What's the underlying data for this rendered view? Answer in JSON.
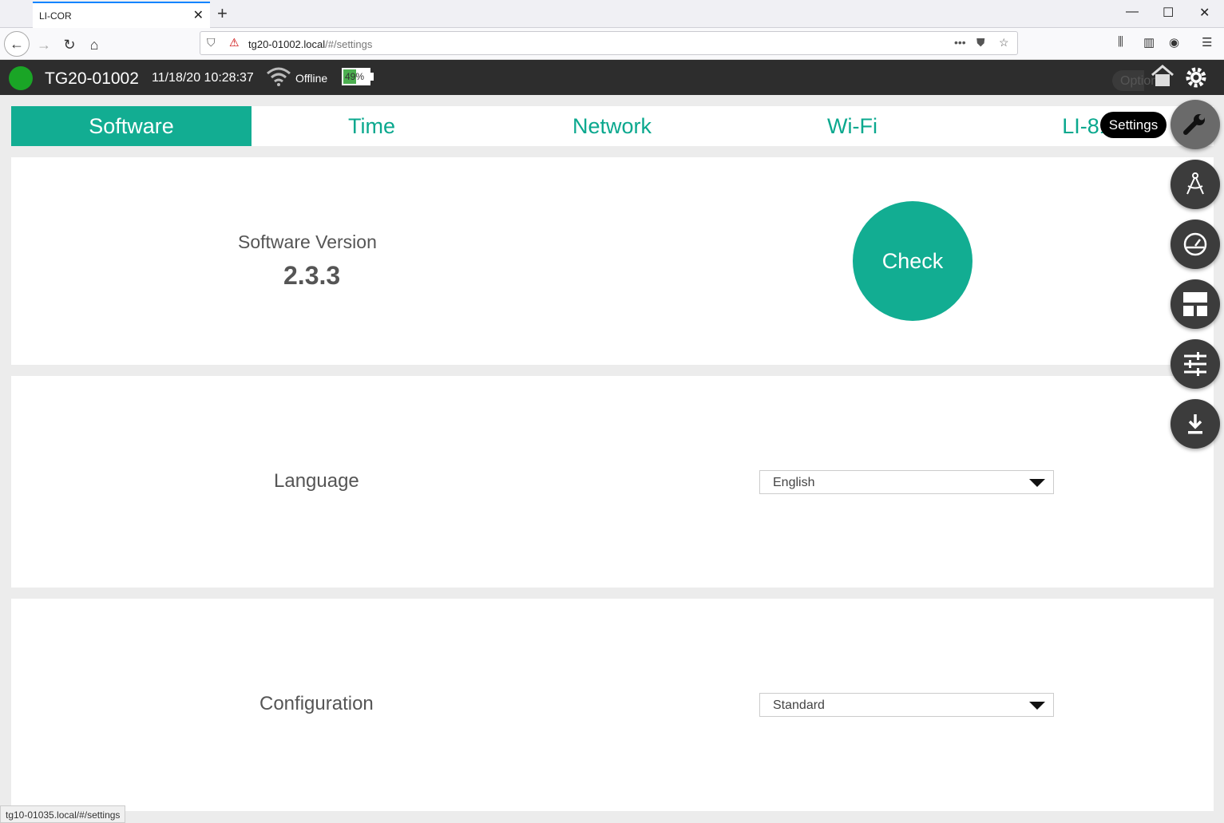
{
  "browser": {
    "tab_title": "LI-COR",
    "url_host": "tg20-01002.local",
    "url_path": "/#/settings",
    "status_url": "tg10-01035.local/#/settings"
  },
  "appbar": {
    "device": "TG20-01002",
    "datetime": "11/18/20 10:28:37",
    "connection": "Offline",
    "battery": "49%",
    "battery_level": 0.49,
    "options": "Options"
  },
  "tabs": [
    {
      "label": "Software"
    },
    {
      "label": "Time"
    },
    {
      "label": "Network"
    },
    {
      "label": "Wi-Fi"
    },
    {
      "label": "LI-810"
    }
  ],
  "software": {
    "label": "Software Version",
    "version": "2.3.3",
    "check_label": "Check"
  },
  "language": {
    "label": "Language",
    "value": "English"
  },
  "configuration": {
    "label": "Configuration",
    "value": "Standard"
  },
  "tooltip": "Settings",
  "colors": {
    "accent": "#12ad92",
    "status_ok": "#1aa526",
    "appbar_bg": "#2d2d2d"
  }
}
